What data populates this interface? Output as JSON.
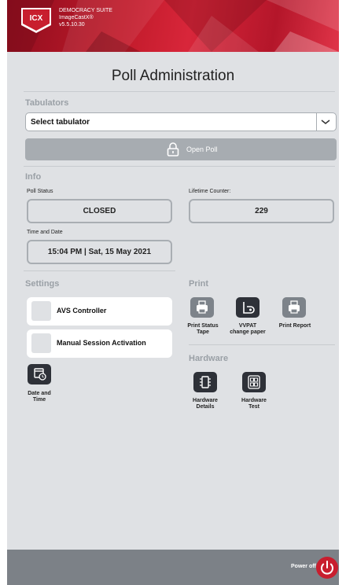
{
  "header": {
    "logo_text": "ICX",
    "suite_lines": [
      "DEMOCRACY SUITE",
      "ImageCastX®",
      "v5.5.10.30"
    ]
  },
  "page_title": "Poll Administration",
  "tabulators": {
    "section_label": "Tabulators",
    "select_value": "Select tabulator",
    "open_poll_label": "Open Poll"
  },
  "info": {
    "section_label": "Info",
    "poll_status_label": "Poll Status",
    "poll_status_value": "CLOSED",
    "lifetime_counter_label": "Lifetime Counter:",
    "lifetime_counter_value": "229",
    "time_date_label": "Time and Date",
    "time_date_value": "15:04 PM | Sat, 15 May 2021"
  },
  "settings": {
    "section_label": "Settings",
    "toggles": [
      "AVS Controller",
      "Manual Session Activation"
    ],
    "date_time_label": "Date and Time"
  },
  "print": {
    "section_label": "Print",
    "buttons": [
      "Print Status Tape",
      "VVPAT change paper",
      "Print Report"
    ]
  },
  "hardware": {
    "section_label": "Hardware",
    "buttons": [
      "Hardware Details",
      "Hardware Test"
    ]
  },
  "footer": {
    "power_off_label": "Power off"
  },
  "colors": {
    "brand_red": "#c81e2e",
    "panel_bg": "#dfe1e4",
    "dark_button": "#2e3138",
    "grey_button": "#7d838a"
  }
}
